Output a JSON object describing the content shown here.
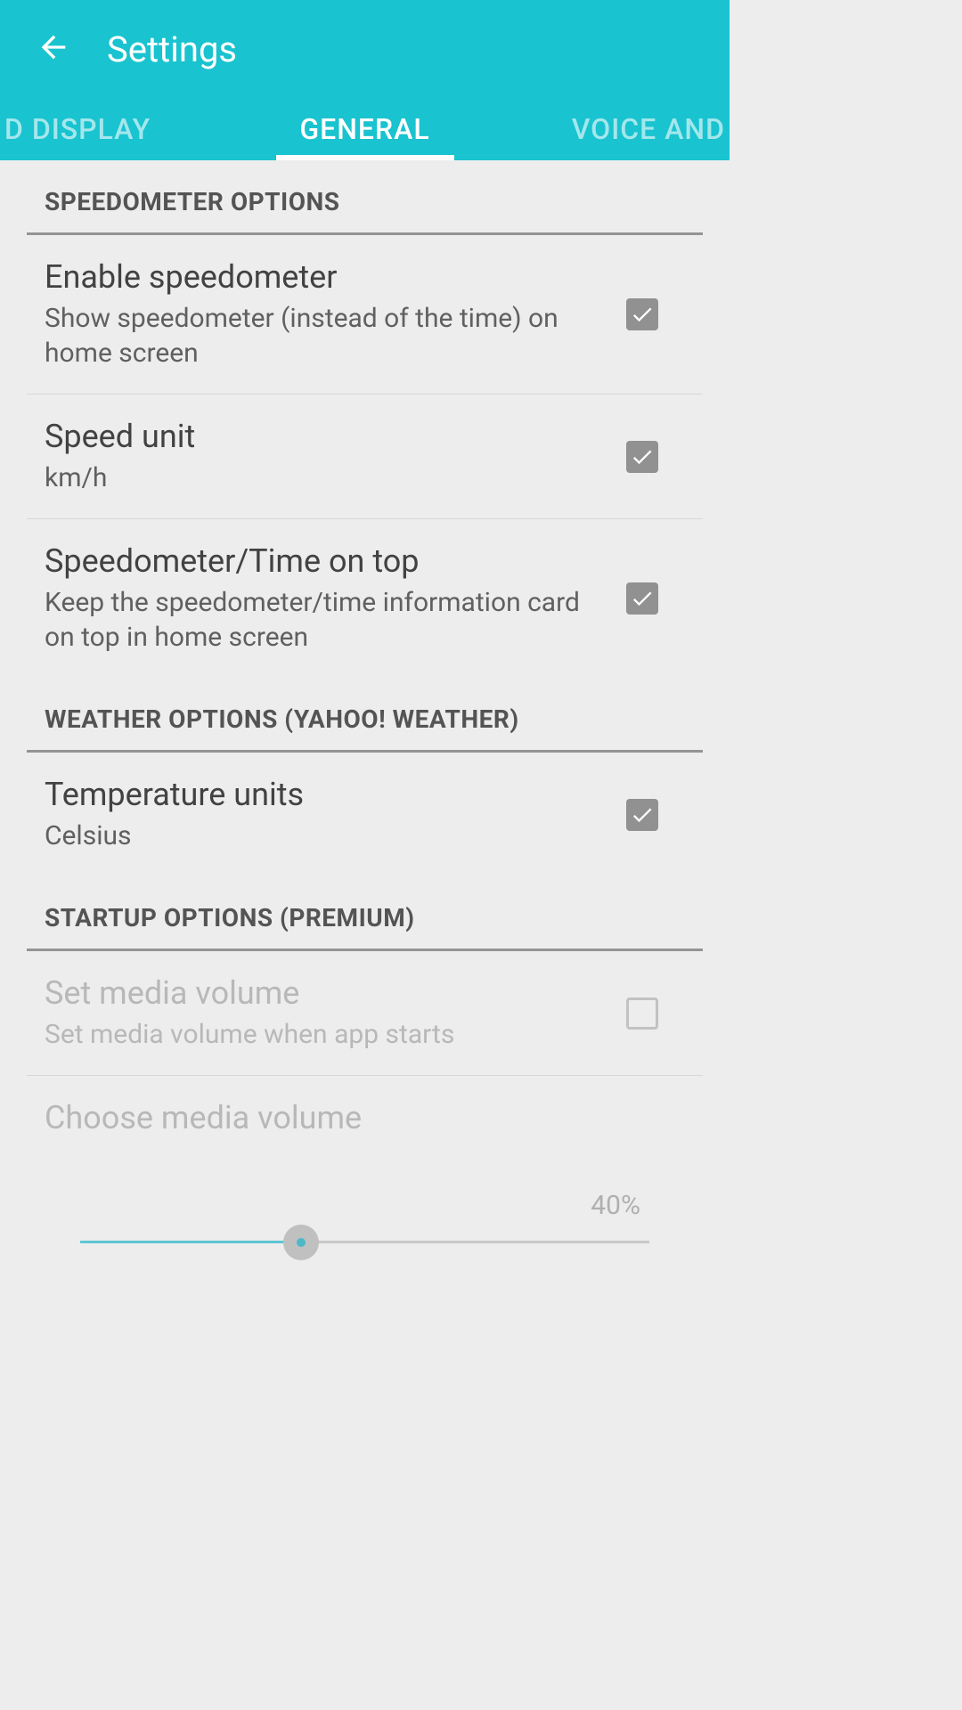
{
  "header": {
    "title": "Settings"
  },
  "tabs": {
    "left": "D DISPLAY",
    "center": "GENERAL",
    "right": "VOICE AND"
  },
  "sections": {
    "speedometer": {
      "header": "SPEEDOMETER OPTIONS",
      "enable": {
        "title": "Enable speedometer",
        "subtitle": "Show speedometer (instead of the time) on home screen"
      },
      "unit": {
        "title": "Speed unit",
        "subtitle": "km/h"
      },
      "ontop": {
        "title": "Speedometer/Time on top",
        "subtitle": "Keep the speedometer/time information card on top in home screen"
      }
    },
    "weather": {
      "header": "WEATHER OPTIONS (YAHOO! WEATHER)",
      "temp": {
        "title": "Temperature units",
        "subtitle": "Celsius"
      }
    },
    "startup": {
      "header": "STARTUP OPTIONS (PREMIUM)",
      "setvolume": {
        "title": "Set media volume",
        "subtitle": "Set media volume when app starts"
      },
      "choosevolume": {
        "title": "Choose media volume",
        "percent": "40%"
      }
    }
  }
}
